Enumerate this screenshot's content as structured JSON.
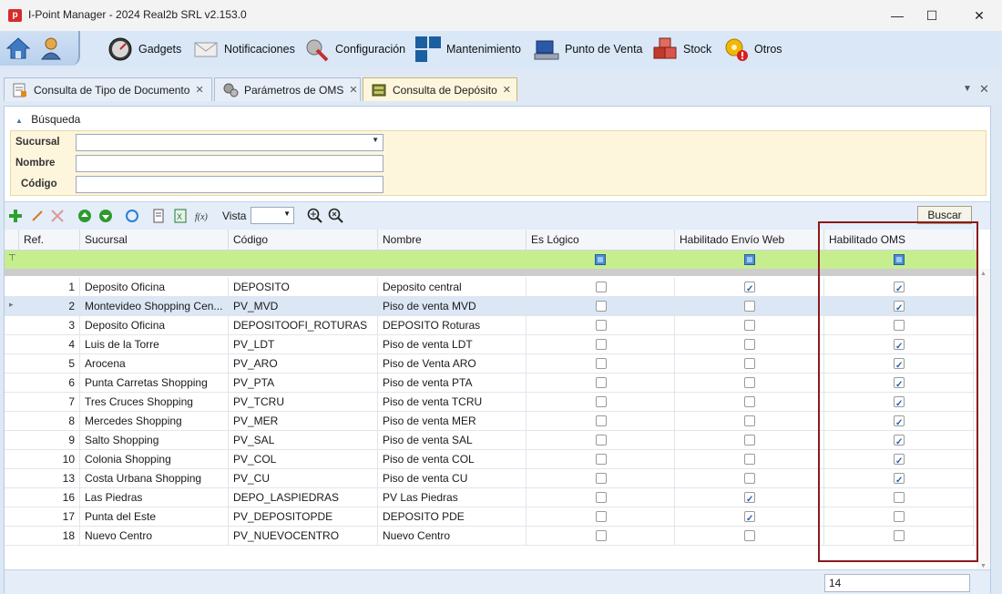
{
  "window": {
    "title": "I-Point Manager - 2024 Real2b SRL v2.153.0",
    "app_icon_letter": "p"
  },
  "window_controls": {
    "minimize": "—",
    "maximize": "☐",
    "close": "✕"
  },
  "ribbon": {
    "items": [
      {
        "label": "Gadgets",
        "icon": "gauge-icon"
      },
      {
        "label": "Notificaciones",
        "icon": "mail-icon"
      },
      {
        "label": "Configuración",
        "icon": "wrench-icon"
      },
      {
        "label": "Mantenimiento",
        "icon": "grid-icon"
      },
      {
        "label": "Punto de Venta",
        "icon": "pos-icon"
      },
      {
        "label": "Stock",
        "icon": "boxes-icon"
      },
      {
        "label": "Otros",
        "icon": "gear-warning-icon"
      }
    ]
  },
  "tabs": [
    {
      "label": "Consulta de Tipo de Documento",
      "close": "✕",
      "active": false
    },
    {
      "label": "Parámetros de OMS",
      "close": "✕",
      "active": false
    },
    {
      "label": "Consulta de Depósito",
      "close": "✕",
      "active": true
    }
  ],
  "search": {
    "header": "Búsqueda",
    "fields": [
      {
        "label": "Sucursal",
        "value": ""
      },
      {
        "label": "Nombre",
        "value": ""
      },
      {
        "label": "Código",
        "value": ""
      }
    ]
  },
  "toolbar": {
    "vista_label": "Vista",
    "vista_value": "",
    "buscar_label": "Buscar"
  },
  "grid": {
    "columns": [
      "Ref.",
      "Sucursal",
      "Código",
      "Nombre",
      "Es Lógico",
      "Habilitado Envío Web",
      "Habilitado OMS"
    ],
    "rows": [
      {
        "ref": "1",
        "sucursal": "Deposito Oficina",
        "codigo": "DEPOSITO",
        "nombre": "Deposito central",
        "logico": false,
        "web": true,
        "oms": true
      },
      {
        "ref": "2",
        "sucursal": "Montevideo Shopping Cen...",
        "codigo": "PV_MVD",
        "nombre": "Piso de venta MVD",
        "logico": false,
        "web": false,
        "oms": true,
        "selected": true
      },
      {
        "ref": "3",
        "sucursal": "Deposito Oficina",
        "codigo": "DEPOSITOOFI_ROTURAS",
        "nombre": "DEPOSITO Roturas",
        "logico": false,
        "web": false,
        "oms": false
      },
      {
        "ref": "4",
        "sucursal": "Luis de la Torre",
        "codigo": "PV_LDT",
        "nombre": "Piso de venta LDT",
        "logico": false,
        "web": false,
        "oms": true
      },
      {
        "ref": "5",
        "sucursal": "Arocena",
        "codigo": "PV_ARO",
        "nombre": "Piso de Venta ARO",
        "logico": false,
        "web": false,
        "oms": true
      },
      {
        "ref": "6",
        "sucursal": "Punta Carretas Shopping",
        "codigo": "PV_PTA",
        "nombre": "Piso de venta PTA",
        "logico": false,
        "web": false,
        "oms": true
      },
      {
        "ref": "7",
        "sucursal": "Tres Cruces Shopping",
        "codigo": "PV_TCRU",
        "nombre": "Piso de venta TCRU",
        "logico": false,
        "web": false,
        "oms": true
      },
      {
        "ref": "8",
        "sucursal": "Mercedes Shopping",
        "codigo": "PV_MER",
        "nombre": "Piso de venta MER",
        "logico": false,
        "web": false,
        "oms": true
      },
      {
        "ref": "9",
        "sucursal": "Salto Shopping",
        "codigo": "PV_SAL",
        "nombre": "Piso de venta SAL",
        "logico": false,
        "web": false,
        "oms": true
      },
      {
        "ref": "10",
        "sucursal": "Colonia Shopping",
        "codigo": "PV_COL",
        "nombre": "Piso de venta COL",
        "logico": false,
        "web": false,
        "oms": true
      },
      {
        "ref": "13",
        "sucursal": "Costa Urbana Shopping",
        "codigo": "PV_CU",
        "nombre": "Piso de venta CU",
        "logico": false,
        "web": false,
        "oms": true
      },
      {
        "ref": "16",
        "sucursal": "Las Piedras",
        "codigo": "DEPO_LASPIEDRAS",
        "nombre": "PV Las Piedras",
        "logico": false,
        "web": true,
        "oms": false
      },
      {
        "ref": "17",
        "sucursal": "Punta del Este",
        "codigo": "PV_DEPOSITOPDE",
        "nombre": "DEPOSITO PDE",
        "logico": false,
        "web": true,
        "oms": false
      },
      {
        "ref": "18",
        "sucursal": "Nuevo Centro",
        "codigo": "PV_NUEVOCENTRO",
        "nombre": "Nuevo Centro",
        "logico": false,
        "web": false,
        "oms": false
      }
    ]
  },
  "footer": {
    "count": "14"
  },
  "colors": {
    "filter_row": "#c6ee8f",
    "search_panel": "#fdf5dc",
    "highlight": "#8b1a1a",
    "selected_row": "#dce7f5"
  }
}
